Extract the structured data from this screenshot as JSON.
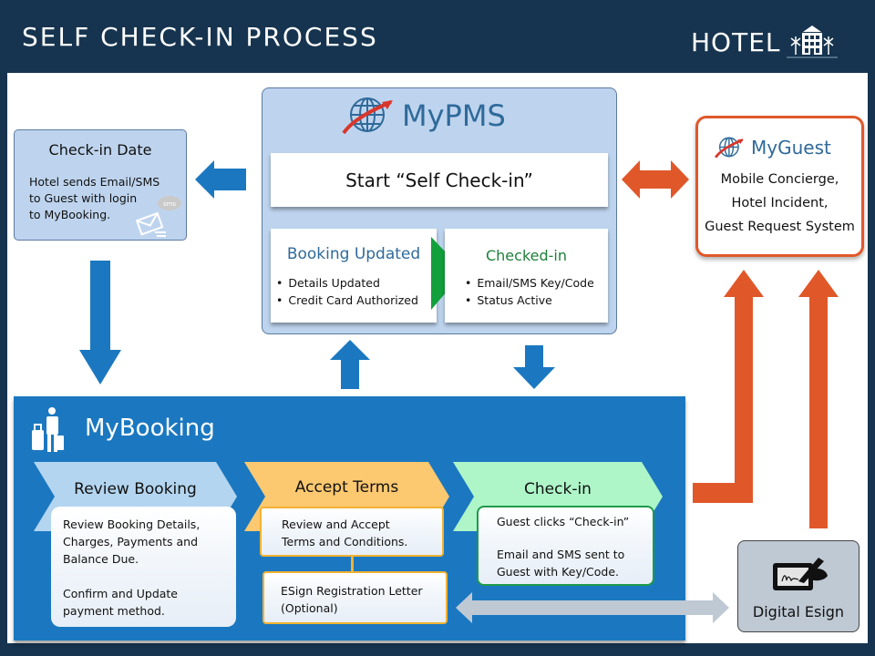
{
  "header": {
    "title": "SELF CHECK-IN PROCESS",
    "logo_text": "HOTEL",
    "logo_icon": "hotel-building-icon"
  },
  "checkin_date": {
    "title": "Check-in Date",
    "lines": [
      "Hotel sends Email/SMS",
      "to Guest with login",
      "to MyBooking."
    ],
    "icon": "email-sms-icon",
    "sms_badge": "sms"
  },
  "mypms": {
    "name": "MyPMS",
    "start_label": "Start “Self Check-in”",
    "booking_updated": {
      "title": "Booking Updated",
      "items": [
        "Details Updated",
        "Credit Card Authorized"
      ]
    },
    "checked_in": {
      "title": "Checked-in",
      "items": [
        "Email/SMS Key/Code",
        "Status  Active"
      ]
    }
  },
  "myguest": {
    "name": "MyGuest",
    "lines": [
      "Mobile Concierge,",
      "Hotel Incident,",
      "Guest Request System"
    ]
  },
  "mybooking": {
    "title": "MyBooking",
    "steps": [
      {
        "label": "Review  Booking",
        "notes": [
          "Review Booking Details,",
          "Charges, Payments and",
          "Balance Due."
        ],
        "notes2": [
          "Confirm  and Update",
          "payment  method."
        ]
      },
      {
        "label": "Accept Terms",
        "notes": [
          "Review and Accept",
          "Terms and Conditions."
        ],
        "extra": [
          "ESign Registration Letter",
          "(Optional)"
        ]
      },
      {
        "label": "Check-in",
        "notes": [
          "Guest clicks “Check-in”"
        ],
        "notes2": [
          "Email and SMS sent to",
          "Guest with Key/Code."
        ]
      }
    ]
  },
  "digital_esign": {
    "label": "Digital Esign",
    "icon": "tablet-signature-icon"
  },
  "colors": {
    "header_bg": "#16344f",
    "panel_light_blue": "#bed4ee",
    "mybooking_blue": "#1b78c0",
    "arrow_blue": "#1b78c0",
    "arrow_orange": "#e0582a",
    "arrow_gray": "#bfc9d4",
    "step_review": "#b3d5f0",
    "step_accept": "#fcc870",
    "step_checkin": "#aef5c8",
    "green_triangle": "#12a03c",
    "text_blue": "#2f6a9a",
    "text_green": "#1e7f3a"
  }
}
